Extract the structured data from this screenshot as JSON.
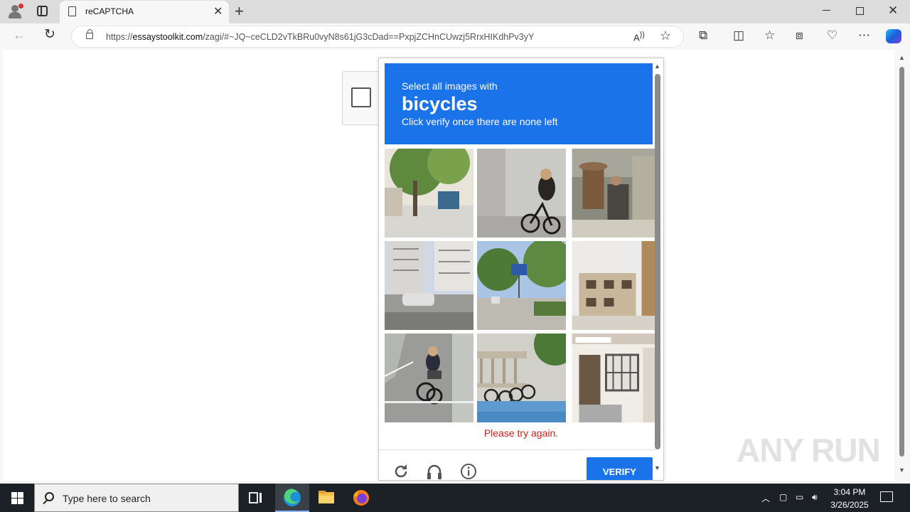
{
  "browser": {
    "tab_title": "reCAPTCHA",
    "url_prefix": "https://",
    "url_domain": "essaystoolkit.com",
    "url_rest": "/zagi/#~JQ~ceCLD2vTkBRu0vyN8s61jG3cDad==PxpjZCHnCUwzj5RrxHIKdhPv3yY"
  },
  "challenge": {
    "instruction_line1": "Select all images with",
    "target": "bicycles",
    "instruction_line2": "Click verify once there are none left",
    "error": "Please try again.",
    "verify_label": "VERIFY",
    "tiles": [
      {
        "label": "street with trees and scooter"
      },
      {
        "label": "woman riding bicycle on sidewalk"
      },
      {
        "label": "market stall with people"
      },
      {
        "label": "apartment buildings and car"
      },
      {
        "label": "street with parking sign"
      },
      {
        "label": "beige apartment building"
      },
      {
        "label": "woman cycling on road"
      },
      {
        "label": "parked bicycles by railing"
      },
      {
        "label": "building entrance with grille"
      }
    ]
  },
  "watermark": "ANY RUN",
  "taskbar": {
    "search_placeholder": "Type here to search",
    "time": "3:04 PM",
    "date": "3/26/2025"
  }
}
